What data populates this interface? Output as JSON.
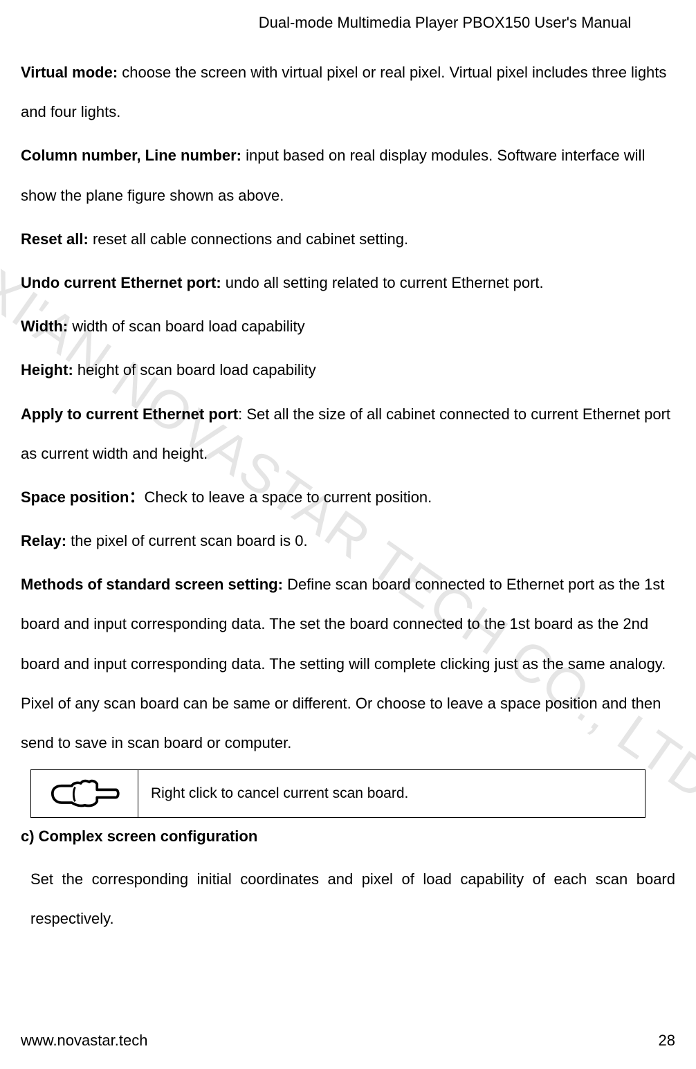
{
  "header": {
    "title": "Dual-mode Multimedia Player PBOX150 User's Manual"
  },
  "definitions": [
    {
      "term": "Virtual mode:",
      "desc": " choose the screen with virtual pixel or real pixel. Virtual pixel includes three lights and four lights."
    },
    {
      "term": "Column number, Line number:",
      "desc": " input based on real display modules. Software interface will show the plane figure shown as above."
    },
    {
      "term": "Reset all:",
      "desc": " reset all cable connections and cabinet setting."
    },
    {
      "term": "Undo current Ethernet port:",
      "desc": " undo all setting related to current Ethernet port."
    },
    {
      "term": "Width:",
      "desc": " width of scan board load capability"
    },
    {
      "term": "Height:",
      "desc": " height of scan board load capability"
    },
    {
      "term": "Apply to current Ethernet port",
      "desc": ": Set all the size of all cabinet connected to current Ethernet port as current width and height."
    },
    {
      "term": "Space position：",
      "desc": "Check to leave a space to current position."
    },
    {
      "term": "Relay:",
      "desc": " the pixel of current scan board is 0."
    },
    {
      "term": "Methods of standard screen setting:",
      "desc": " Define scan board connected to Ethernet port as the 1st board and input corresponding data. The set the board connected to the 1st board as the 2nd board and input corresponding data. The setting will complete clicking just as the same analogy. Pixel of any scan board can be same or different. Or choose to leave a space position and then send to save in scan board or computer."
    }
  ],
  "note": {
    "text": "Right click to cancel current scan board."
  },
  "section": {
    "label": "c)    Complex screen configuration",
    "paragraph": "Set the corresponding initial coordinates and pixel of load capability of each scan board respectively."
  },
  "footer": {
    "url": "www.novastar.tech",
    "page": "28"
  },
  "watermark": "XI'AN NOVASTAR TECH CO., LTD"
}
